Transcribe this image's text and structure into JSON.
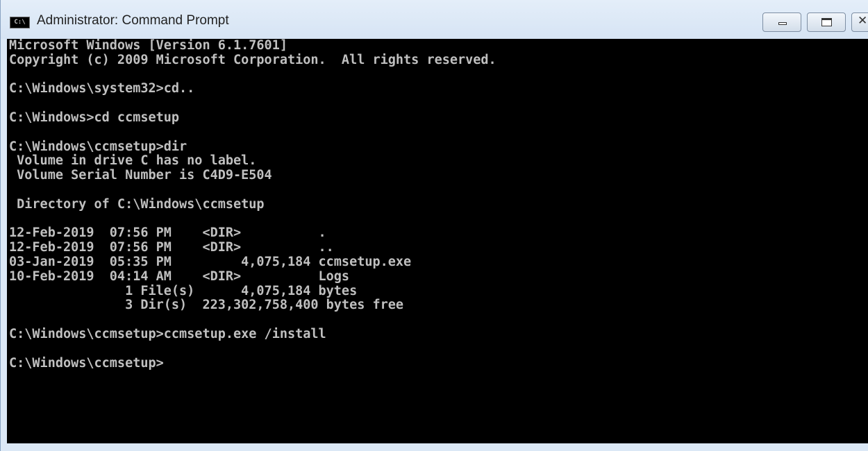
{
  "window": {
    "title": "Administrator: Command Prompt",
    "icon": "cmd-icon",
    "icon_label": "C:\\",
    "controls": {
      "minimize_icon": "minimize-icon",
      "maximize_icon": "maximize-icon",
      "close_icon": "close-icon",
      "close_glyph": "✕"
    }
  },
  "colors": {
    "console_background": "#000000",
    "console_text": "#c0c0c0",
    "frame": "#dbe8f6"
  },
  "console": {
    "lines": [
      "Microsoft Windows [Version 6.1.7601]",
      "Copyright (c) 2009 Microsoft Corporation.  All rights reserved.",
      "",
      "C:\\Windows\\system32>cd..",
      "",
      "C:\\Windows>cd ccmsetup",
      "",
      "C:\\Windows\\ccmsetup>dir",
      " Volume in drive C has no label.",
      " Volume Serial Number is C4D9-E504",
      "",
      " Directory of C:\\Windows\\ccmsetup",
      "",
      "12-Feb-2019  07:56 PM    <DIR>          .",
      "12-Feb-2019  07:56 PM    <DIR>          ..",
      "03-Jan-2019  05:35 PM         4,075,184 ccmsetup.exe",
      "10-Feb-2019  04:14 AM    <DIR>          Logs",
      "               1 File(s)      4,075,184 bytes",
      "               3 Dir(s)  223,302,758,400 bytes free",
      "",
      "C:\\Windows\\ccmsetup>ccmsetup.exe /install",
      "",
      "C:\\Windows\\ccmsetup>"
    ]
  }
}
